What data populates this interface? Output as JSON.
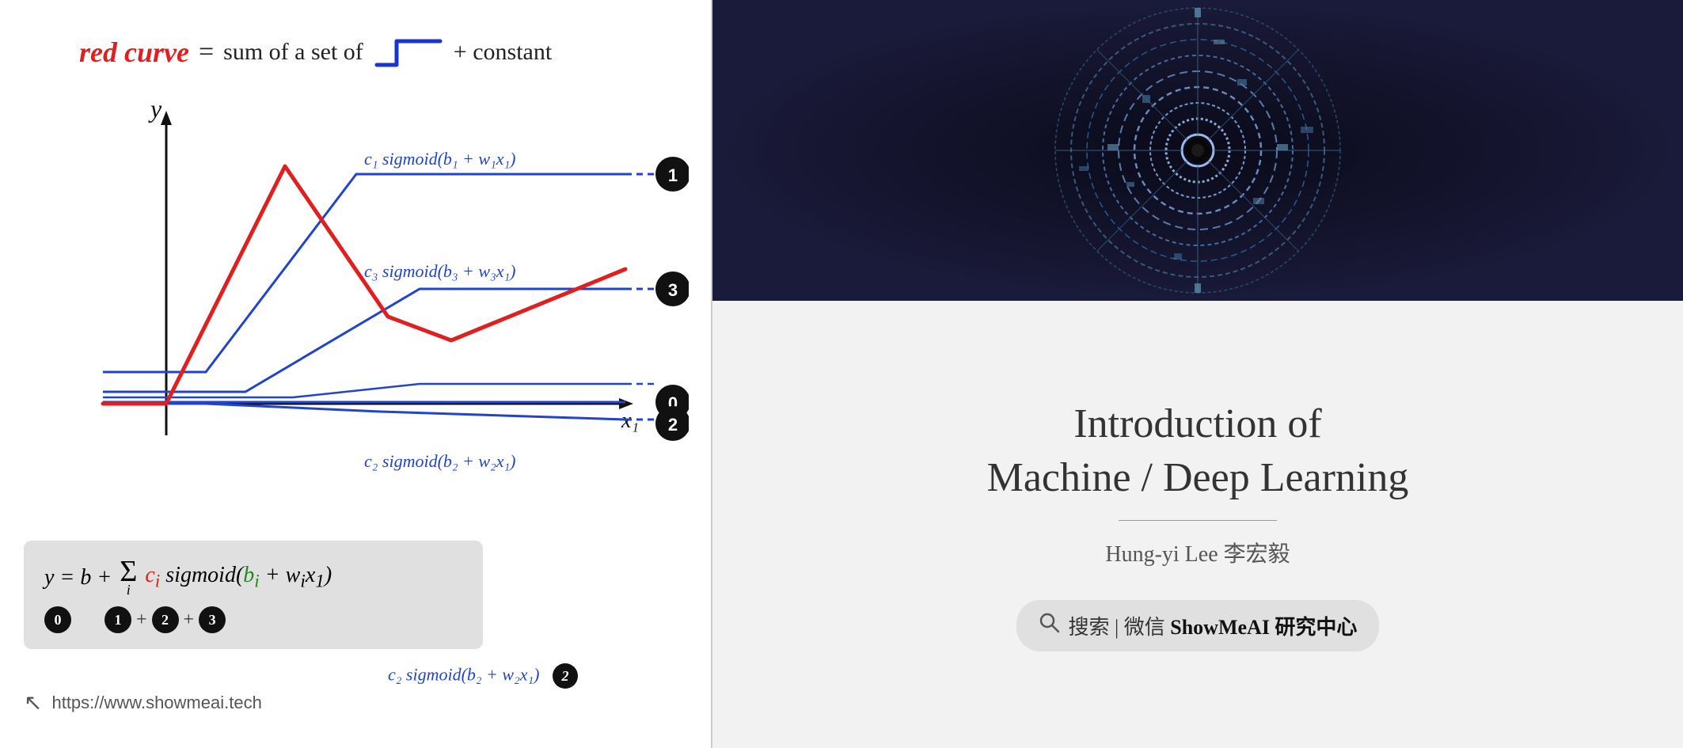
{
  "left": {
    "top_formula": {
      "red_curve_label": "red curve",
      "equals": "=",
      "sum_text": "sum of a set of",
      "plus_constant": "+ constant"
    },
    "chart": {
      "y_axis_label": "y",
      "x_axis_label": "x₁"
    },
    "annotations": {
      "sigmoid1": "c₁ sigmoid(b₁ + w₁x₁)",
      "sigmoid2": "c₂ sigmoid(b₂ + w₂x₁)",
      "sigmoid3": "c₃ sigmoid(b₃ + w₃x₁)",
      "badge1": "1",
      "badge2": "2",
      "badge3": "3",
      "badge0": "0"
    },
    "formula_box": {
      "text": "y = b +",
      "sum_symbol": "Σ",
      "sum_sub": "i",
      "ci_label": "cᵢ sigmoid(bᵢ + wᵢx₁)",
      "badges": [
        "0",
        "1",
        "+",
        "2",
        "+",
        "3"
      ]
    },
    "url": "https://www.showmeai.tech"
  },
  "right": {
    "title_line1": "Introduction of",
    "title_line2": "Machine / Deep Learning",
    "author": "Hung-yi Lee 李宏毅",
    "search_text": "搜索 | 微信 ShowMeAI 研究中心"
  }
}
